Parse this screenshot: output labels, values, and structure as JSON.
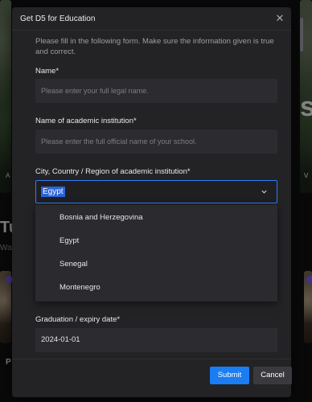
{
  "background": {
    "left_heading_fragment": "Tu",
    "left_sub_fragment": "Wat",
    "left_caption_fragment": "A",
    "right_heading_fragment": "s",
    "right_caption_fragment": "V",
    "left_bottom_fragment": "P"
  },
  "modal": {
    "title": "Get D5 for Education",
    "close_icon": "close-icon",
    "intro": "Please fill in the following form. Make sure the information given is true and correct.",
    "fields": {
      "name": {
        "label": "Name*",
        "placeholder": "Please enter your full legal name."
      },
      "institution": {
        "label": "Name of academic institution*",
        "placeholder": "Please enter the full official name of your school."
      },
      "location": {
        "label": "City, Country / Region of academic institution*",
        "value": "Egypt",
        "options": [
          "Bosnia and Herzegovina",
          "Egypt",
          "Senegal",
          "Montenegro"
        ]
      },
      "graduation": {
        "label": "Graduation / expiry date*",
        "value": "2024-01-01"
      }
    },
    "buttons": {
      "submit": "Submit",
      "cancel": "Cancel"
    }
  },
  "colors": {
    "accent": "#1a7df2",
    "selection": "#2c63d8",
    "modal_bg": "#232326"
  }
}
